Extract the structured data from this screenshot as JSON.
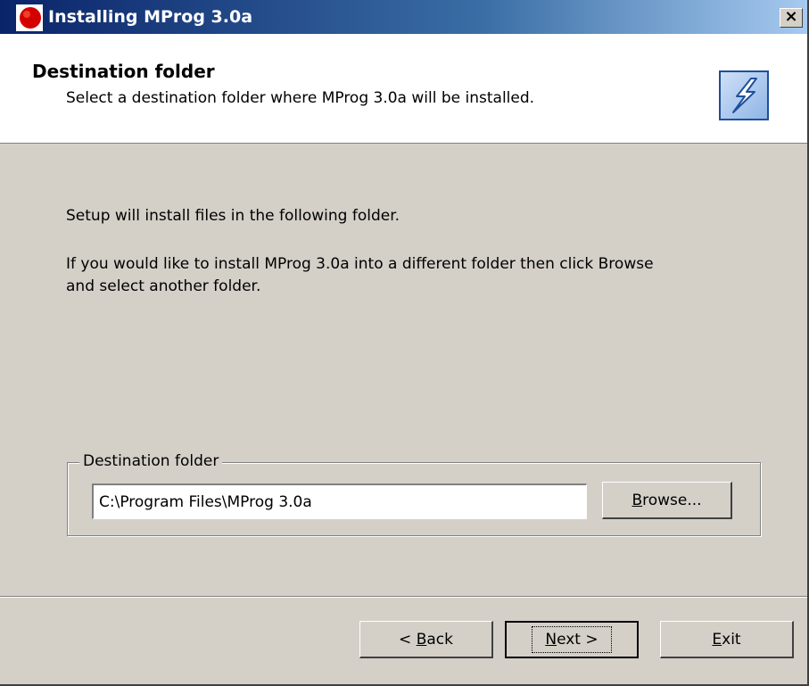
{
  "window": {
    "title": "Installing MProg 3.0a",
    "close_label": "×"
  },
  "header": {
    "title": "Destination folder",
    "subtitle": "Select a destination folder where MProg 3.0a will be installed."
  },
  "body": {
    "line1": "Setup will install files in the following folder.",
    "line2": "If you would like to install MProg 3.0a into a different folder then click Browse",
    "line3": "and select another folder."
  },
  "destination": {
    "legend": "Destination folder",
    "path_value": "C:\\Program Files\\MProg 3.0a",
    "browse": {
      "mnemonic": "B",
      "rest": "rowse..."
    }
  },
  "buttons": {
    "back": {
      "prefix": "< ",
      "mnemonic": "B",
      "rest": "ack"
    },
    "next": {
      "mnemonic": "N",
      "rest": "ext >"
    },
    "exit": {
      "mnemonic": "E",
      "rest": "xit"
    }
  },
  "colors": {
    "titlebar_start": "#0a246a",
    "titlebar_end": "#a6caf0",
    "dialog_bg": "#d4d0c8"
  }
}
